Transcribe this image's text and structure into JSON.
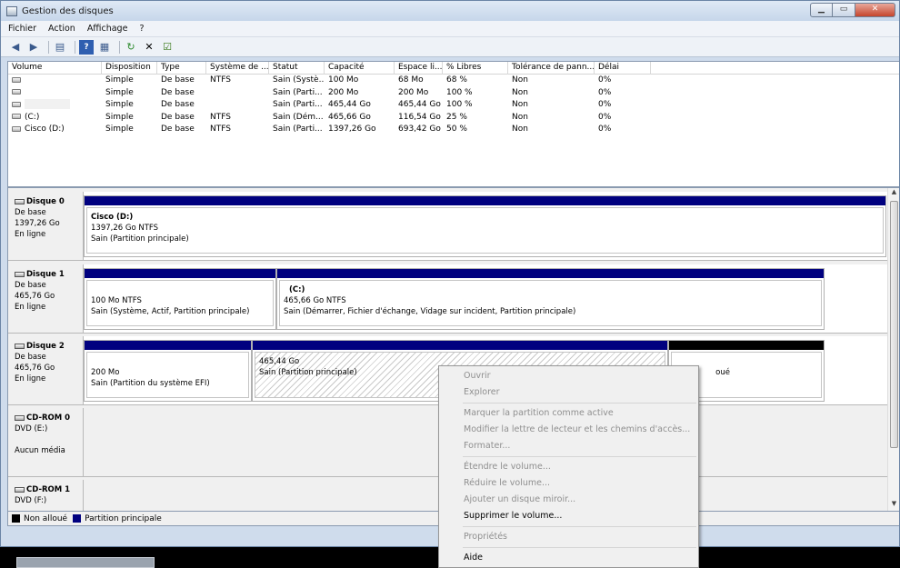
{
  "window": {
    "title": "Gestion des disques"
  },
  "menu": [
    "Fichier",
    "Action",
    "Affichage",
    "?"
  ],
  "table": {
    "columns": [
      "Volume",
      "Disposition",
      "Type",
      "Système de ...",
      "Statut",
      "Capacité",
      "Espace li...",
      "% Libres",
      "Tolérance de pann...",
      "Délai"
    ],
    "rows": [
      {
        "volume": "",
        "disposition": "Simple",
        "type": "De base",
        "fs": "NTFS",
        "statut": "Sain (Systè...",
        "capacite": "100 Mo",
        "espace": "68 Mo",
        "libres": "68 %",
        "tolerance": "Non",
        "delai": "0%"
      },
      {
        "volume": "",
        "disposition": "Simple",
        "type": "De base",
        "fs": "",
        "statut": "Sain (Parti...",
        "capacite": "200 Mo",
        "espace": "200 Mo",
        "libres": "100 %",
        "tolerance": "Non",
        "delai": "0%"
      },
      {
        "volume": "",
        "disposition": "Simple",
        "type": "De base",
        "fs": "",
        "statut": "Sain (Parti...",
        "capacite": "465,44 Go",
        "espace": "465,44 Go",
        "libres": "100 %",
        "tolerance": "Non",
        "delai": "0%"
      },
      {
        "volume": "(C:)",
        "disposition": "Simple",
        "type": "De base",
        "fs": "NTFS",
        "statut": "Sain (Dém...",
        "capacite": "465,66 Go",
        "espace": "116,54 Go",
        "libres": "25 %",
        "tolerance": "Non",
        "delai": "0%"
      },
      {
        "volume": "Cisco (D:)",
        "disposition": "Simple",
        "type": "De base",
        "fs": "NTFS",
        "statut": "Sain (Parti...",
        "capacite": "1397,26 Go",
        "espace": "693,42 Go",
        "libres": "50 %",
        "tolerance": "Non",
        "delai": "0%"
      }
    ]
  },
  "disks": {
    "disk0": {
      "name": "Disque 0",
      "type": "De base",
      "size": "1397,26 Go",
      "status": "En ligne",
      "p1": {
        "name": "Cisco  (D:)",
        "size": "1397,26 Go NTFS",
        "status": "Sain (Partition principale)"
      }
    },
    "disk1": {
      "name": "Disque 1",
      "type": "De base",
      "size": "465,76 Go",
      "status": "En ligne",
      "p1": {
        "size": "100 Mo NTFS",
        "status": "Sain (Système, Actif, Partition principale)"
      },
      "p2": {
        "name": "(C:)",
        "size": "465,66 Go NTFS",
        "status": "Sain (Démarrer, Fichier d'échange, Vidage sur incident, Partition principale)"
      }
    },
    "disk2": {
      "name": "Disque 2",
      "type": "De base",
      "size": "465,76 Go",
      "status": "En ligne",
      "p1": {
        "size": "200 Mo",
        "status": "Sain (Partition du système EFI)"
      },
      "p2": {
        "size": "465,44 Go",
        "status": "Sain (Partition principale)"
      },
      "p3": {
        "status": "oué"
      }
    },
    "cd0": {
      "name": "CD-ROM 0",
      "drive": "DVD (E:)",
      "status": "Aucun média"
    },
    "cd1": {
      "name": "CD-ROM 1",
      "drive": "DVD (F:)"
    }
  },
  "legend": {
    "unallocated": "Non alloué",
    "primary": "Partition principale"
  },
  "context_menu": {
    "open": "Ouvrir",
    "explore": "Explorer",
    "mark_active": "Marquer la partition comme active",
    "change_letter": "Modifier la lettre de lecteur et les chemins d'accès...",
    "format": "Formater...",
    "extend": "Étendre le volume...",
    "shrink": "Réduire le volume...",
    "mirror": "Ajouter un disque miroir...",
    "delete": "Supprimer le volume...",
    "properties": "Propriétés",
    "help": "Aide"
  }
}
